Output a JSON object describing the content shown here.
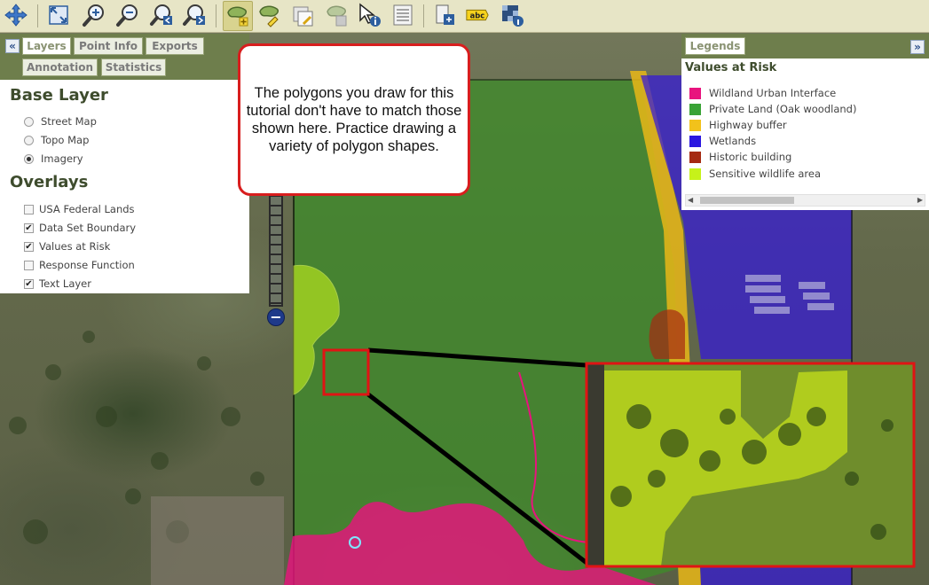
{
  "toolbar": {
    "icons": [
      "pan-icon",
      "full-extent-icon",
      "zoom-in-icon",
      "zoom-out-icon",
      "zoom-previous-icon",
      "zoom-next-icon",
      "draw-polygon-icon",
      "edit-polygon-icon",
      "clear-selection-icon",
      "delete-polygon-icon",
      "identify-icon",
      "attribute-table-icon",
      "print-icon",
      "label-icon",
      "overview-icon"
    ],
    "label_icon_text": "abc"
  },
  "left_panel": {
    "tabs_row1": [
      "Layers",
      "Point Info",
      "Exports"
    ],
    "tabs_row2": [
      "Annotation",
      "Statistics"
    ],
    "collapse_symbol": "«",
    "base_layer_heading": "Base Layer",
    "base_layers": [
      {
        "label": "Street Map",
        "selected": false
      },
      {
        "label": "Topo Map",
        "selected": false
      },
      {
        "label": "Imagery",
        "selected": true
      }
    ],
    "overlays_heading": "Overlays",
    "overlays": [
      {
        "label": "USA Federal Lands",
        "checked": false
      },
      {
        "label": "Data Set Boundary",
        "checked": true
      },
      {
        "label": "Values at Risk",
        "checked": true
      },
      {
        "label": "Response Function",
        "checked": false
      },
      {
        "label": "Text Layer",
        "checked": true
      }
    ]
  },
  "legend": {
    "tab_label": "Legends",
    "expand_symbol": "»",
    "title": "Values at Risk",
    "items": [
      {
        "label": "Wildland Urban Interface",
        "color": "#e8137e"
      },
      {
        "label": "Private Land (Oak woodland)",
        "color": "#3aa336"
      },
      {
        "label": "Highway buffer",
        "color": "#f2c21b"
      },
      {
        "label": "Wetlands",
        "color": "#2a17e0"
      },
      {
        "label": "Historic building",
        "color": "#a52a12"
      },
      {
        "label": "Sensitive wildlife area",
        "color": "#c6f21a"
      }
    ]
  },
  "callout": {
    "text": "The polygons you draw for this tutorial don't have to match those shown here. Practice drawing a variety of polygon shapes."
  },
  "zoom_slider": {
    "minus_symbol": "−"
  },
  "colors": {
    "toolbar_bg": "#e7e5c6",
    "panel_tab_bar": "#6e7e4c",
    "heading": "#3e4c2d",
    "callout_border": "#d81e1e",
    "highlight_box": "#e01414"
  }
}
